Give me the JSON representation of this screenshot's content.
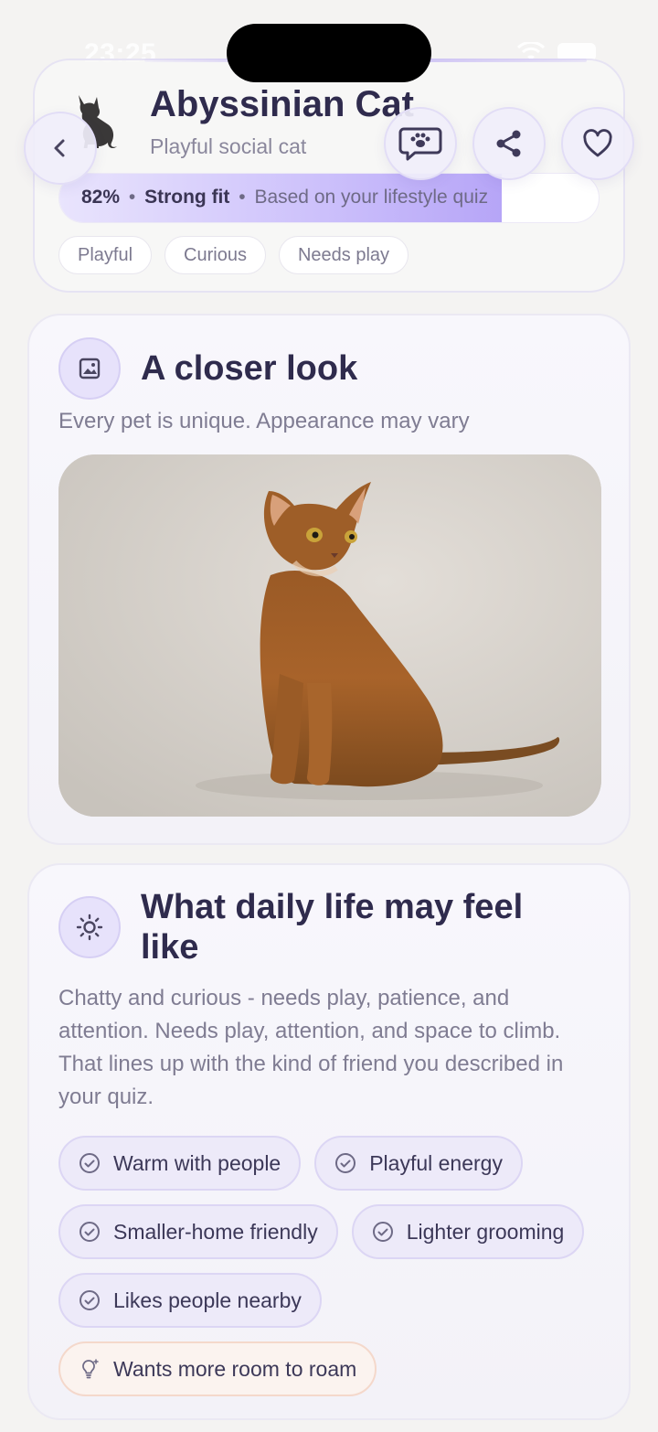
{
  "status": {
    "time": "23:25"
  },
  "header": {
    "breed": "Abyssinian Cat",
    "tagline": "Playful social cat",
    "fit": {
      "percent_label": "82%",
      "percent": 82,
      "label": "Strong fit",
      "note": "Based on your lifestyle quiz",
      "separator": "•"
    },
    "tags": [
      "Playful",
      "Curious",
      "Needs play"
    ]
  },
  "actions": {
    "back": "back-icon",
    "chat": "paw-chat-icon",
    "share": "share-icon",
    "favorite": "heart-icon"
  },
  "closer_look": {
    "title": "A closer look",
    "subtitle": "Every pet is unique. Appearance may vary",
    "icon": "image-icon"
  },
  "daily_life": {
    "title": "What daily life may feel like",
    "description": "Chatty and curious - needs play, patience, and attention. Needs play, attention, and space to climb. That lines up with the kind of friend you described in your quiz.",
    "icon": "sun-icon",
    "chips": [
      {
        "label": "Warm with people",
        "kind": "positive"
      },
      {
        "label": "Playful energy",
        "kind": "positive"
      },
      {
        "label": "Smaller-home friendly",
        "kind": "positive"
      },
      {
        "label": "Lighter grooming",
        "kind": "positive"
      },
      {
        "label": "Likes people nearby",
        "kind": "positive"
      },
      {
        "label": "Wants more room to roam",
        "kind": "consider"
      }
    ]
  },
  "colors": {
    "accent": "#c9bdf4",
    "text": "#2f2b4d",
    "muted": "#7f7c92"
  }
}
